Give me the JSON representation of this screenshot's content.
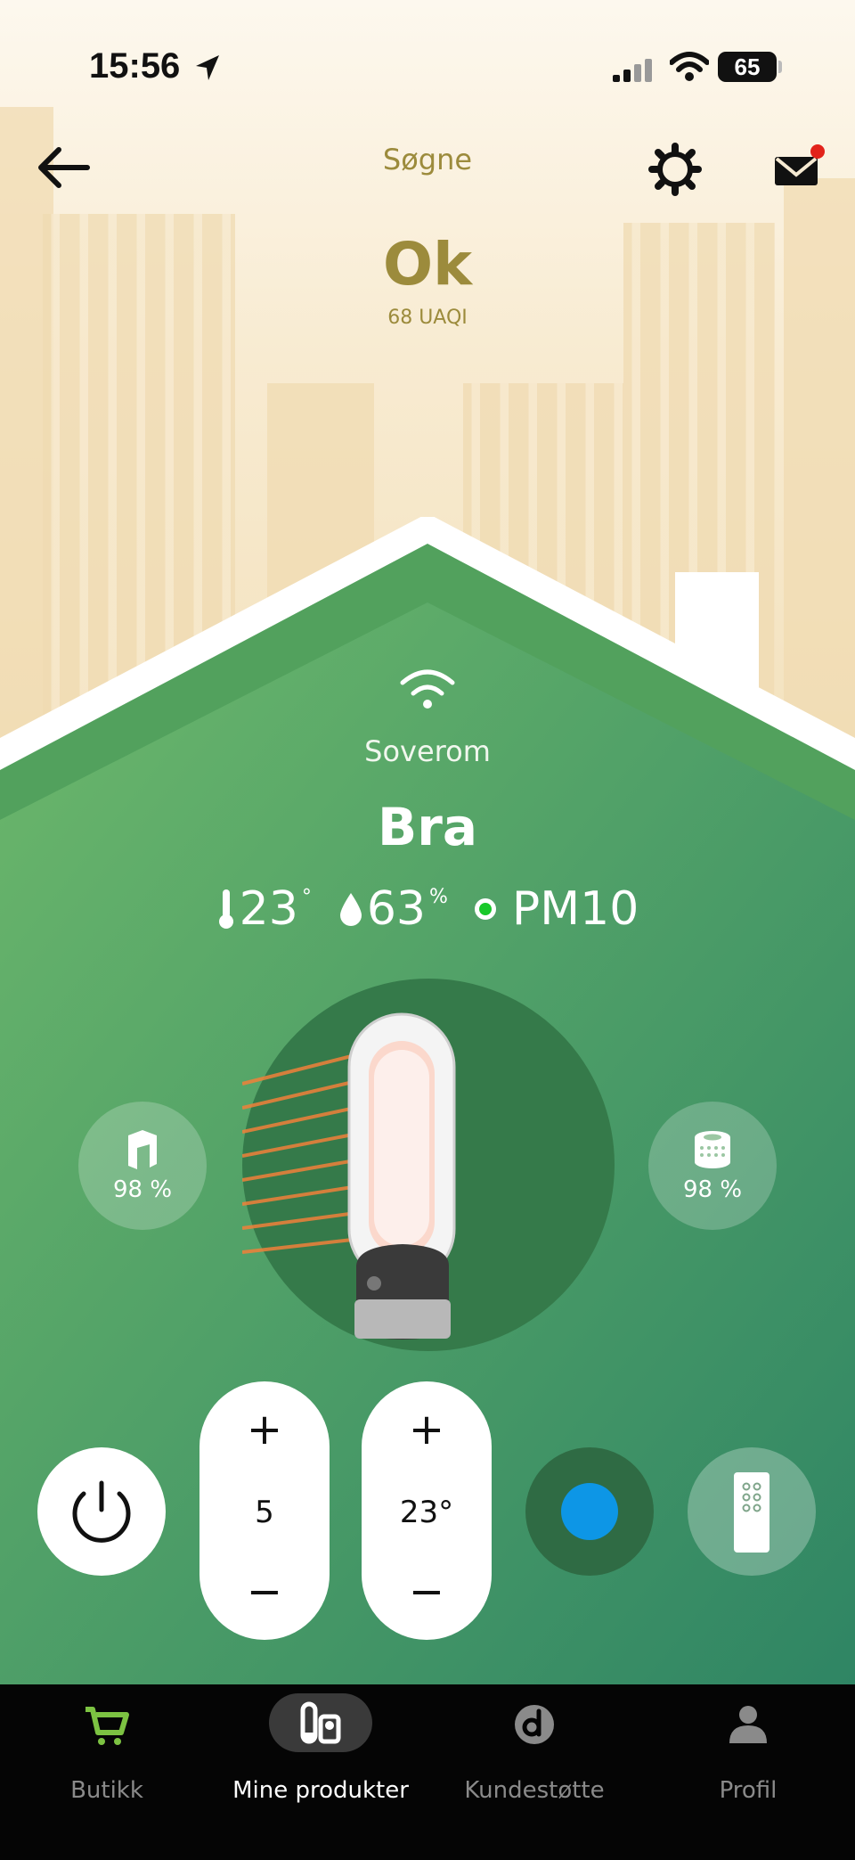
{
  "status_bar": {
    "time": "15:56",
    "battery": "65"
  },
  "header": {
    "location": "Søgne"
  },
  "outdoor": {
    "status": "Ok",
    "index": "68 UAQI"
  },
  "room": {
    "name": "Soverom",
    "status": "Bra",
    "temperature": "23",
    "humidity": "63",
    "pollutant": "PM10",
    "pollutant_color": "#19c82a"
  },
  "filters": {
    "left_pct": "98 %",
    "right_pct": "98 %"
  },
  "controls": {
    "fan_speed": "5",
    "target_temp": "23°",
    "plus": "+",
    "minus": "−",
    "mode_color": "#0d96e6"
  },
  "tabs": [
    {
      "label": "Butikk",
      "icon": "cart-icon"
    },
    {
      "label": "Mine produkter",
      "icon": "products-icon"
    },
    {
      "label": "Kundestøtte",
      "icon": "support-icon"
    },
    {
      "label": "Profil",
      "icon": "profile-icon"
    }
  ],
  "colors": {
    "accent_gold": "#9c8b3c",
    "house_green": "#4f9f62",
    "tab_active_green": "#7cc242"
  }
}
